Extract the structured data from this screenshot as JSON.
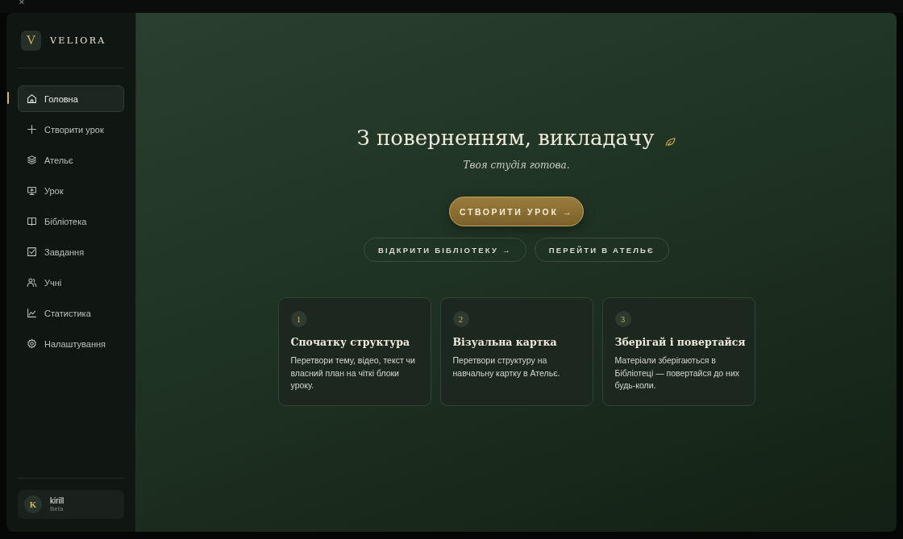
{
  "brand": {
    "logo_letter": "V",
    "name": "VELIORA"
  },
  "nav": [
    {
      "label": "Головна",
      "selected": true
    },
    {
      "label": "Створити урок",
      "selected": false
    },
    {
      "label": "Ательє",
      "selected": false
    },
    {
      "label": "Урок",
      "selected": false
    },
    {
      "label": "Бібліотека",
      "selected": false
    },
    {
      "label": "Завдання",
      "selected": false
    },
    {
      "label": "Учні",
      "selected": false
    },
    {
      "label": "Статистика",
      "selected": false
    },
    {
      "label": "Налаштування",
      "selected": false
    }
  ],
  "user": {
    "initial": "K",
    "name": "kirill",
    "plan": "Beta"
  },
  "hero": {
    "title": "З поверненням, викладачу",
    "subtitle": "Твоя студія готова.",
    "primary_button": "СТВОРИТИ УРОК →",
    "secondary_buttons": [
      "ВІДКРИТИ БІБЛІОТЕКУ →",
      "ПЕРЕЙТИ В АТЕЛЬЄ"
    ]
  },
  "steps": [
    {
      "number": "1",
      "title": "Спочатку структура",
      "text": "Перетвори тему, відео, текст чи власний план на чіткі блоки уроку."
    },
    {
      "number": "2",
      "title": "Візуальна картка",
      "text": "Перетвори структуру на навчальну картку в Ательє."
    },
    {
      "number": "3",
      "title": "Зберігай і повертайся",
      "text": "Матеріали зберігаються в Бібліотеці — повертайся до них будь-коли."
    }
  ]
}
